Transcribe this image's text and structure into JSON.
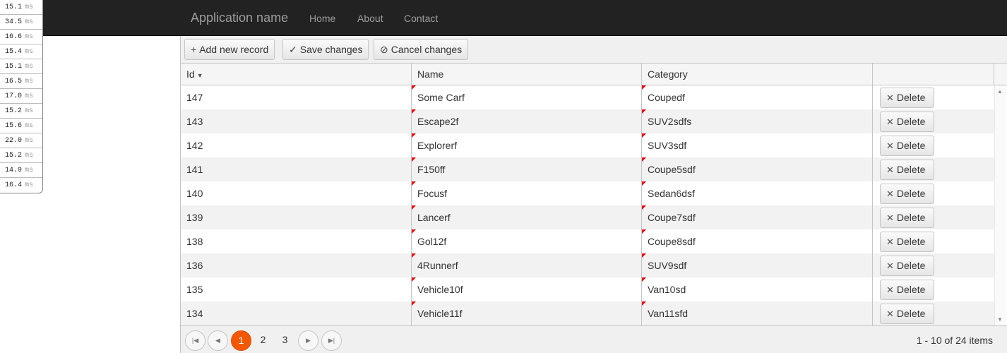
{
  "timings": [
    {
      "value": "15.1",
      "unit": "ms"
    },
    {
      "value": "34.5",
      "unit": "ms"
    },
    {
      "value": "16.6",
      "unit": "ms"
    },
    {
      "value": "15.4",
      "unit": "ms"
    },
    {
      "value": "15.1",
      "unit": "ms"
    },
    {
      "value": "16.5",
      "unit": "ms"
    },
    {
      "value": "17.0",
      "unit": "ms"
    },
    {
      "value": "15.2",
      "unit": "ms"
    },
    {
      "value": "15.6",
      "unit": "ms"
    },
    {
      "value": "22.0",
      "unit": "ms"
    },
    {
      "value": "15.2",
      "unit": "ms"
    },
    {
      "value": "14.9",
      "unit": "ms"
    },
    {
      "value": "16.4",
      "unit": "ms"
    }
  ],
  "navbar": {
    "brand": "Application name",
    "links": [
      "Home",
      "About",
      "Contact"
    ]
  },
  "toolbar": {
    "add_label": "Add new record",
    "save_label": "Save changes",
    "cancel_label": "Cancel changes"
  },
  "grid": {
    "columns": [
      "Id",
      "Name",
      "Category",
      ""
    ],
    "delete_label": "Delete",
    "rows": [
      {
        "id": "147",
        "name": "Some Carf",
        "category": "Coupedf"
      },
      {
        "id": "143",
        "name": "Escape2f",
        "category": "SUV2sdfs"
      },
      {
        "id": "142",
        "name": "Explorerf",
        "category": "SUV3sdf"
      },
      {
        "id": "141",
        "name": "F150ff",
        "category": "Coupe5sdf"
      },
      {
        "id": "140",
        "name": "Focusf",
        "category": "Sedan6dsf"
      },
      {
        "id": "139",
        "name": "Lancerf",
        "category": "Coupe7sdf"
      },
      {
        "id": "138",
        "name": "Gol12f",
        "category": "Coupe8sdf"
      },
      {
        "id": "136",
        "name": "4Runnerf",
        "category": "SUV9sdf"
      },
      {
        "id": "135",
        "name": "Vehicle10f",
        "category": "Van10sd"
      },
      {
        "id": "134",
        "name": "Vehicle11f",
        "category": "Van11sfd"
      }
    ]
  },
  "pager": {
    "pages": [
      "1",
      "2",
      "3"
    ],
    "current_page": "1",
    "info": "1 - 10 of 24 items"
  },
  "colors": {
    "navbar_bg": "#222222",
    "accent": "#f35800",
    "dirty_marker": "#ee0000"
  }
}
